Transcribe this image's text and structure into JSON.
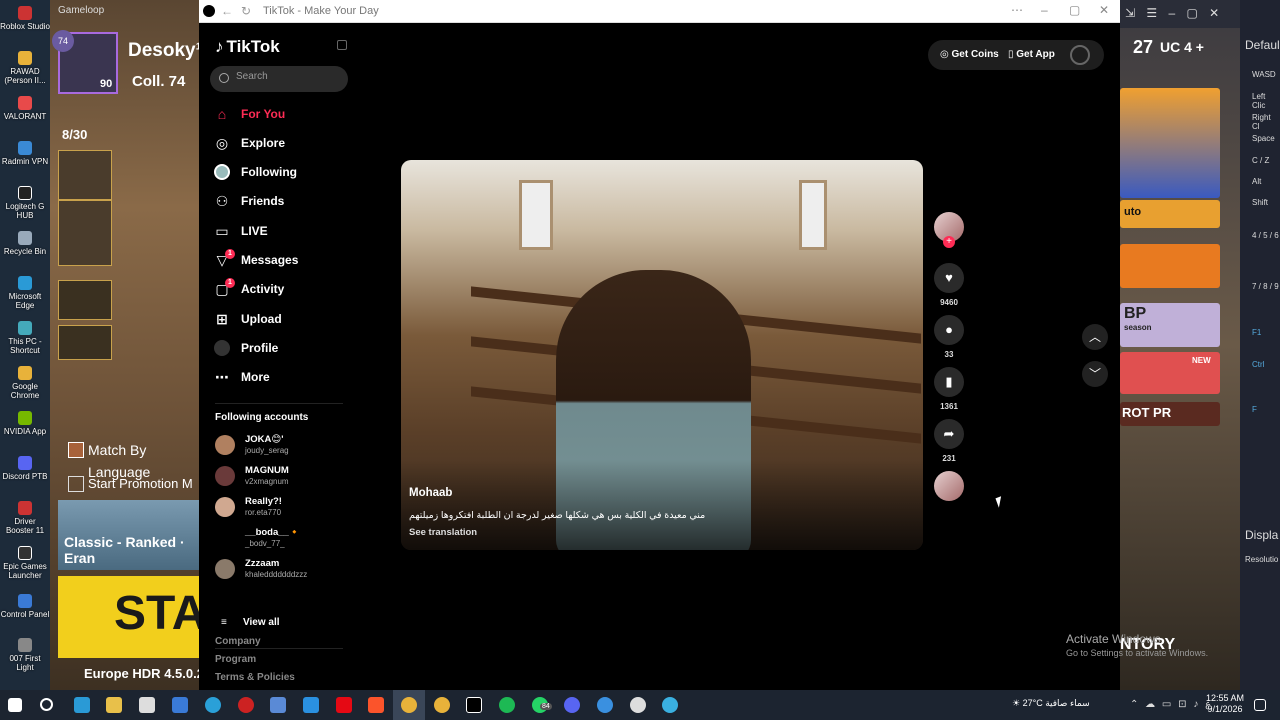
{
  "desktop": {
    "icons": [
      "Roblox Studio",
      "RAWAD (Person II...",
      "VALORANT",
      "Radmin VPN",
      "Logitech G HUB",
      "Recycle Bin",
      "Microsoft Edge",
      "This PC - Shortcut",
      "Google Chrome",
      "NVIDIA App",
      "Discord PTB",
      "Driver Booster 11",
      "Epic Games Launcher",
      "Control Panel",
      "007 First Light"
    ]
  },
  "gameloop": {
    "title": "Gameloop",
    "player_name": "Desoky¹",
    "collection": "Coll. 74",
    "badge_level": "74",
    "avatar_level": "90",
    "squad": "8/30",
    "match_by_language": "Match By Language",
    "start_promotion": "Start Promotion M",
    "mode": "Classic - Ranked · Eran",
    "start": "STAR",
    "region": "Europe HDR",
    "version": "4.5.0.2",
    "currency_num": "27",
    "uc_label": "UC",
    "uc_amount": "4",
    "inventory": "NTORY",
    "bp_card": "BP",
    "bp_season": "season",
    "new_badge": "NEW",
    "auto_card": "uto",
    "rot_card": "ROT PR"
  },
  "keymap": {
    "title": "Defaul",
    "keys": [
      "WASD",
      "Left Clic",
      "Right Cl",
      "Space",
      "C / Z",
      "Alt",
      "Shift",
      "4 / 5 / 6",
      "7 / 8 / 9",
      "F1",
      "Ctrl",
      "F"
    ],
    "display": "Displa",
    "resolution": "Resolutio"
  },
  "browser": {
    "title": "TikTok - Make Your Day"
  },
  "tiktok": {
    "logo": "TikTok",
    "search_placeholder": "Search",
    "nav": [
      {
        "label": "For You",
        "icon": "home-icon"
      },
      {
        "label": "Explore",
        "icon": "compass-icon"
      },
      {
        "label": "Following",
        "icon": "following-avatar-icon"
      },
      {
        "label": "Friends",
        "icon": "friends-icon"
      },
      {
        "label": "LIVE",
        "icon": "live-icon"
      },
      {
        "label": "Messages",
        "icon": "messages-icon",
        "badge": "1"
      },
      {
        "label": "Activity",
        "icon": "activity-icon",
        "badge": "1"
      },
      {
        "label": "Upload",
        "icon": "upload-icon"
      },
      {
        "label": "Profile",
        "icon": "profile-icon"
      },
      {
        "label": "More",
        "icon": "more-icon"
      }
    ],
    "following_title": "Following accounts",
    "accounts": [
      {
        "name": "JOKA😊'",
        "handle": "joudy_serag"
      },
      {
        "name": "MAGNUM",
        "handle": "v2xmagnum"
      },
      {
        "name": "Really?!",
        "handle": "ror.eta770"
      },
      {
        "name": "__boda__🔸",
        "handle": "_bodv_77_"
      },
      {
        "name": "Zzzaam",
        "handle": "khaledddddddzzz"
      }
    ],
    "view_all": "View all",
    "footer": [
      "Company",
      "Program",
      "Terms & Policies"
    ],
    "get_coins": "Get Coins",
    "get_app": "Get App",
    "video": {
      "author": "Mohaab",
      "caption": "مني معيدة في الكلية بس هي شكلها صغير لدرجة ان الطلبة افتكروها زميلتهم",
      "see_translation": "See translation",
      "likes": "9460",
      "comments": "33",
      "saves": "1361",
      "shares": "231"
    }
  },
  "watermark": {
    "line1": "Activate Windows",
    "line2": "Go to Settings to activate Windows."
  },
  "taskbar": {
    "weather_temp": "27°C",
    "weather_text": "سماء صافية",
    "time": "12:55 AM",
    "date": "9/1/2026",
    "lang": "ع",
    "badge": "84"
  }
}
